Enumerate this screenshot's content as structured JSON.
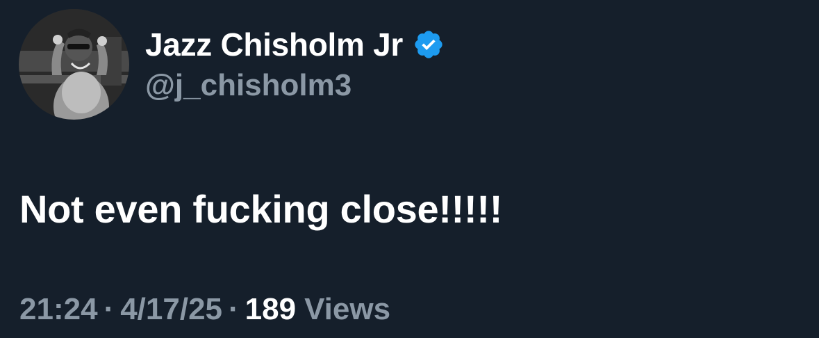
{
  "tweet": {
    "author": {
      "display_name": "Jazz Chisholm Jr",
      "handle": "@j_chisholm3",
      "verified": true,
      "verified_icon": "verified-badge-icon",
      "avatar": "avatar-photo"
    },
    "text": "Not even fucking close!!!!!",
    "meta": {
      "time": "21:24",
      "separator": "·",
      "date": "4/17/25",
      "views_count": "189",
      "views_label": "Views"
    }
  },
  "colors": {
    "background": "#15202b",
    "primary_text": "#ffffff",
    "secondary_text": "#8b98a5",
    "verified_blue": "#1d9bf0"
  }
}
